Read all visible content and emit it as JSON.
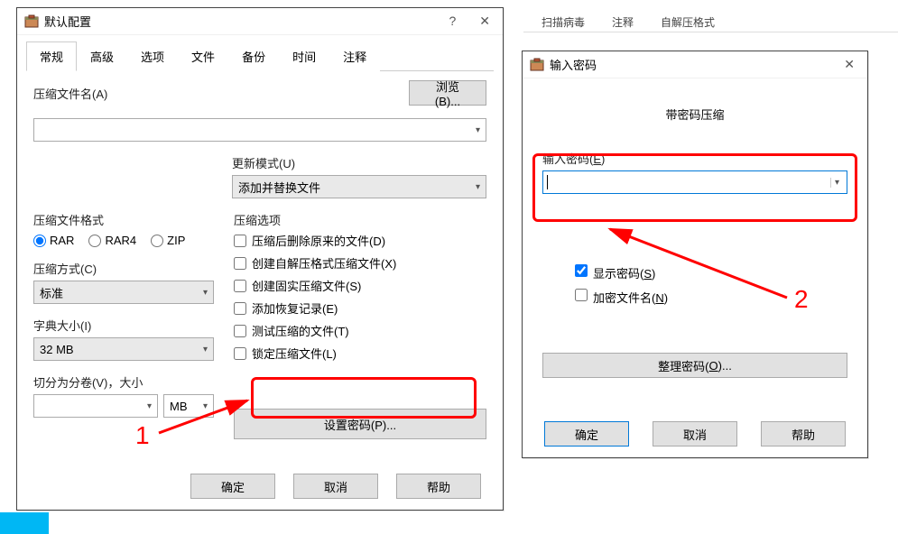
{
  "toolbar": {
    "scan": "扫描病毒",
    "comment": "注释",
    "sfx": "自解压格式"
  },
  "dialog1": {
    "title": "默认配置",
    "tabs": [
      "常规",
      "高级",
      "选项",
      "文件",
      "备份",
      "时间",
      "注释"
    ],
    "archive_name_label": "压缩文件名(A)",
    "browse_btn": "浏览(B)...",
    "update_mode_label": "更新模式(U)",
    "update_mode_value": "添加并替换文件",
    "format_label": "压缩文件格式",
    "formats": [
      "RAR",
      "RAR4",
      "ZIP"
    ],
    "method_label": "压缩方式(C)",
    "method_value": "标准",
    "dict_label": "字典大小(I)",
    "dict_value": "32 MB",
    "volume_label": "切分为分卷(V)，大小",
    "volume_unit": "MB",
    "options_label": "压缩选项",
    "options": [
      "压缩后删除原来的文件(D)",
      "创建自解压格式压缩文件(X)",
      "创建固实压缩文件(S)",
      "添加恢复记录(E)",
      "测试压缩的文件(T)",
      "锁定压缩文件(L)"
    ],
    "set_password_btn": "设置密码(P)...",
    "ok": "确定",
    "cancel": "取消",
    "help": "帮助"
  },
  "dialog2": {
    "title": "输入密码",
    "headline": "带密码压缩",
    "enter_pw_label": "输入密码(E)",
    "show_pw": "显示密码(S)",
    "encrypt_names": "加密文件名(N)",
    "manage_btn": "整理密码(O)...",
    "ok": "确定",
    "cancel": "取消",
    "help": "帮助"
  },
  "annotations": {
    "one": "1",
    "two": "2"
  }
}
